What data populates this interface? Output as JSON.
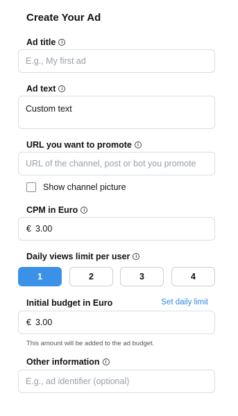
{
  "form": {
    "title": "Create Your Ad",
    "ad_title": {
      "label": "Ad title",
      "placeholder": "E.g., My first ad"
    },
    "ad_text": {
      "label": "Ad text",
      "value": "Custom text"
    },
    "url": {
      "label": "URL you want to promote",
      "placeholder": "URL of the channel, post or bot you promote"
    },
    "show_picture": {
      "label": "Show channel picture",
      "checked": false
    },
    "cpm": {
      "label": "CPM in Euro",
      "currency": "€",
      "value": "3.00"
    },
    "daily_views": {
      "label": "Daily views limit per user",
      "options": [
        "1",
        "2",
        "3",
        "4"
      ],
      "selected": "1"
    },
    "budget": {
      "label": "Initial budget in Euro",
      "link": "Set daily limit",
      "currency": "€",
      "value": "3.00",
      "hint": "This amount will be added to the ad budget."
    },
    "other": {
      "label": "Other information",
      "placeholder": "E.g., ad identifier (optional)"
    }
  },
  "colors": {
    "accent": "#3b91e8",
    "link": "#2f88e0",
    "border": "#d8dde3"
  },
  "icons": {
    "info": "info-circle-icon"
  }
}
